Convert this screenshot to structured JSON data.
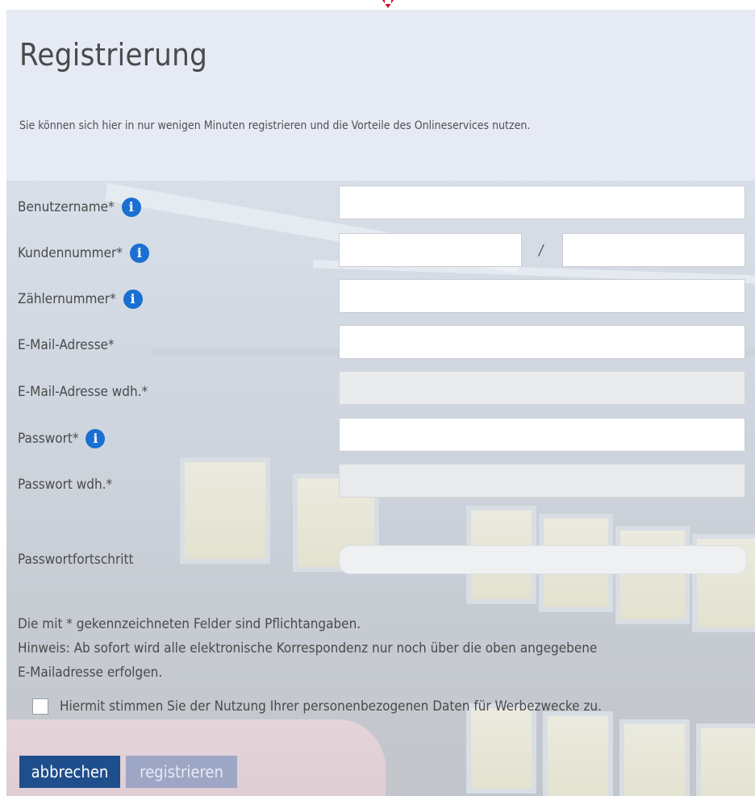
{
  "header": {
    "title": "Registrierung",
    "subtitle": "Sie können sich hier in nur wenigen Minuten registrieren und die Vorteile des Onlineservices nutzen."
  },
  "form": {
    "username": {
      "label": "Benutzername",
      "required_mark": "*",
      "value": ""
    },
    "customer_number": {
      "label": "Kundennummer",
      "required_mark": "*",
      "value_part1": "",
      "separator": "/",
      "value_part2": ""
    },
    "meter_number": {
      "label": "Zählernummer",
      "required_mark": "*",
      "value": ""
    },
    "email": {
      "label": "E-Mail-Adresse",
      "required_mark": "*",
      "value": ""
    },
    "email_repeat": {
      "label": "E-Mail-Adresse wdh.",
      "required_mark": "*",
      "value": "",
      "disabled": true
    },
    "password": {
      "label": "Passwort",
      "required_mark": "*",
      "value": ""
    },
    "password_repeat": {
      "label": "Passwort wdh.",
      "required_mark": "*",
      "value": "",
      "disabled": true
    },
    "password_progress": {
      "label": "Passwortfortschritt",
      "value": 0
    }
  },
  "info_icon": {
    "glyph": "i",
    "color": "#1a6fd1"
  },
  "notes": {
    "required_hint": "Die mit * gekennzeichneten Felder sind Pflichtangaben.",
    "email_hint_line1": "Hinweis: Ab sofort wird alle elektronische Korrespondenz nur noch über die oben angegebene",
    "email_hint_line2": "E-Mailadresse erfolgen."
  },
  "consent": {
    "label": "Hiermit stimmen Sie der Nutzung Ihrer personenbezogenen Daten für Werbezwecke zu.",
    "checked": false
  },
  "buttons": {
    "cancel": "abbrechen",
    "submit": "registrieren"
  },
  "colors": {
    "accent": "#1f4e8c",
    "info": "#1a6fd1",
    "submit_disabled": "#9ea6c5",
    "marker": "#e0001b"
  }
}
